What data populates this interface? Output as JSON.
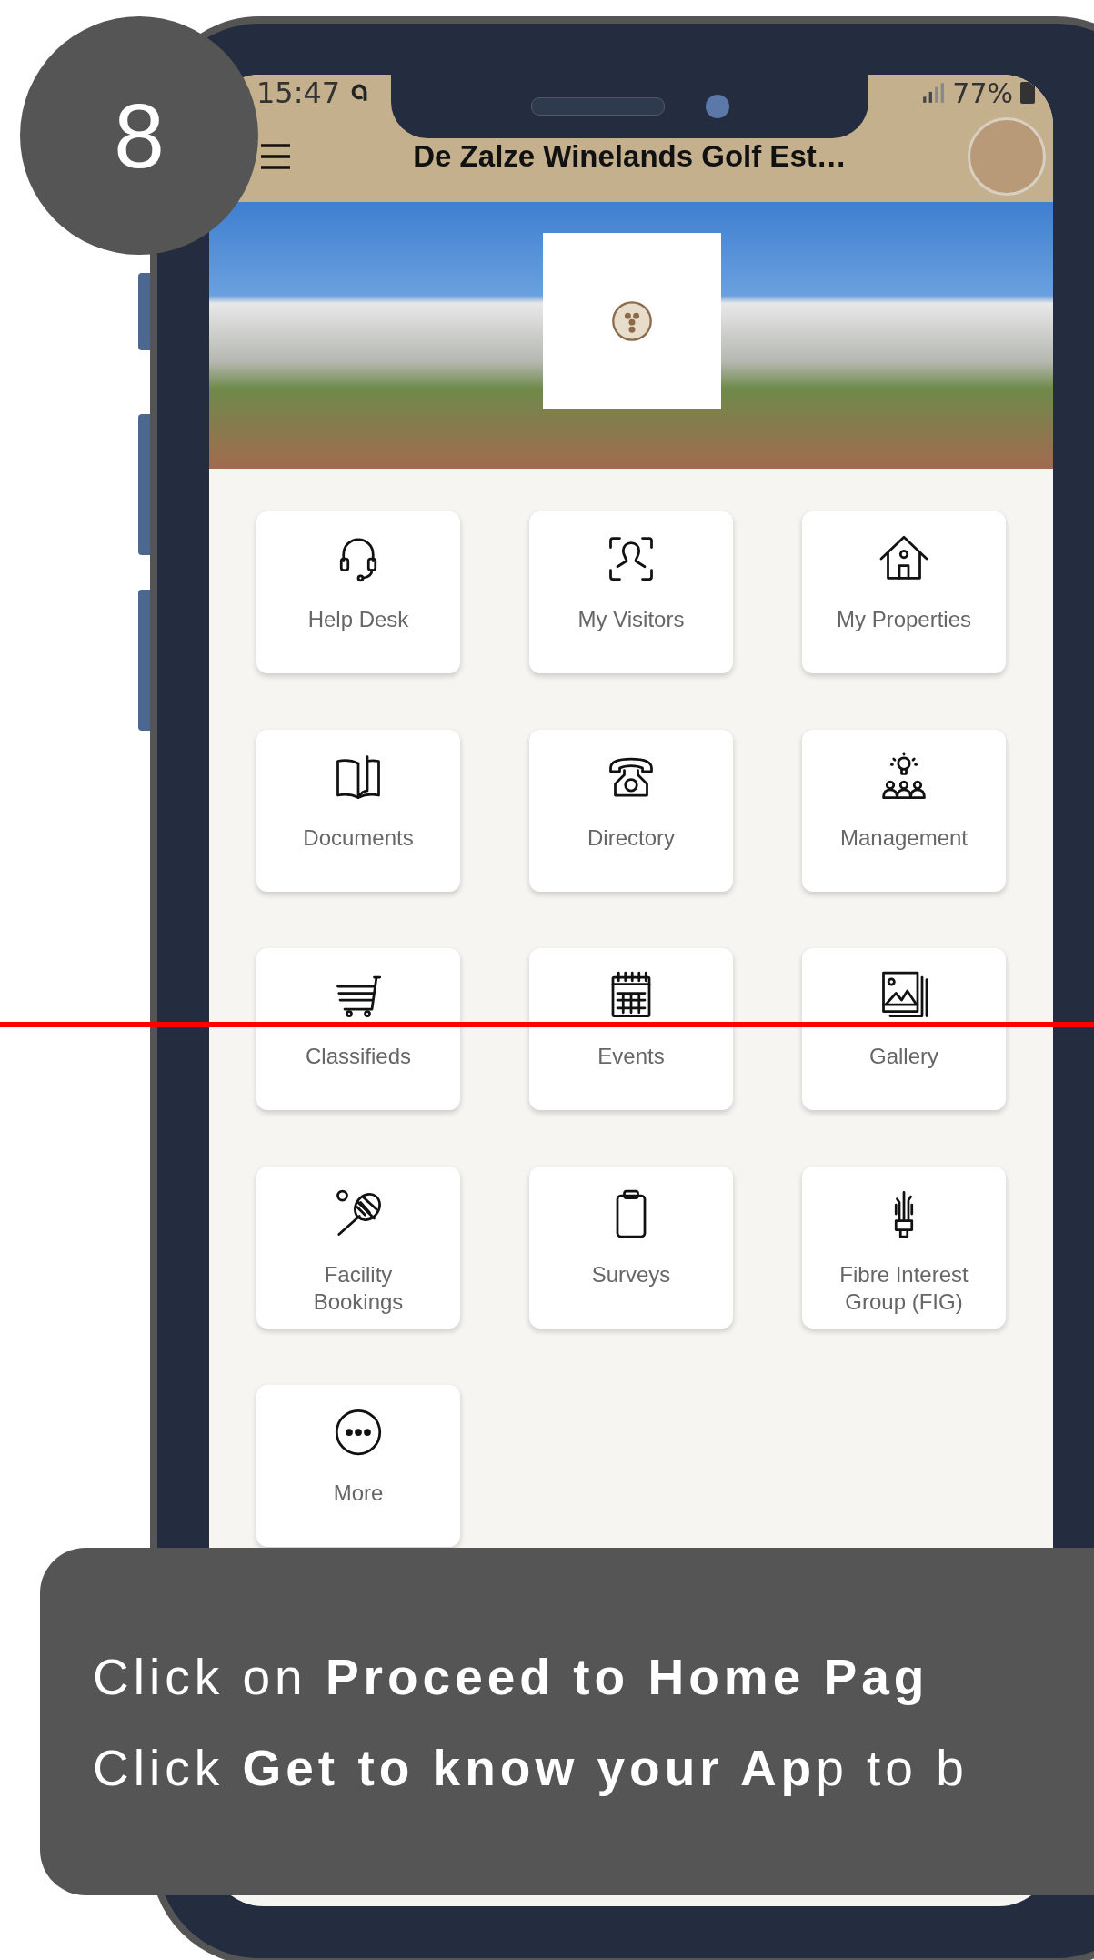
{
  "step": "8",
  "status_bar": {
    "time": "15:47",
    "battery": "77%"
  },
  "header": {
    "title": "De Zalze Winelands Golf Est…"
  },
  "tiles": [
    {
      "label": "Help Desk",
      "kind": "headset"
    },
    {
      "label": "My Visitors",
      "kind": "visitor"
    },
    {
      "label": "My Properties",
      "kind": "house"
    },
    {
      "label": "Documents",
      "kind": "book"
    },
    {
      "label": "Directory",
      "kind": "phone"
    },
    {
      "label": "Management",
      "kind": "team"
    },
    {
      "label": "Classifieds",
      "kind": "cart"
    },
    {
      "label": "Events",
      "kind": "calendar"
    },
    {
      "label": "Gallery",
      "kind": "gallery"
    },
    {
      "label": "Facility Bookings",
      "kind": "racket"
    },
    {
      "label": "Surveys",
      "kind": "clipboard"
    },
    {
      "label": "Fibre Interest Group (FIG)",
      "kind": "fibre"
    },
    {
      "label": "More",
      "kind": "more"
    }
  ],
  "caption": {
    "lines": [
      "Click on **Proceed to Home Pag**",
      "Click **Get to know your Ap**p to b"
    ]
  }
}
